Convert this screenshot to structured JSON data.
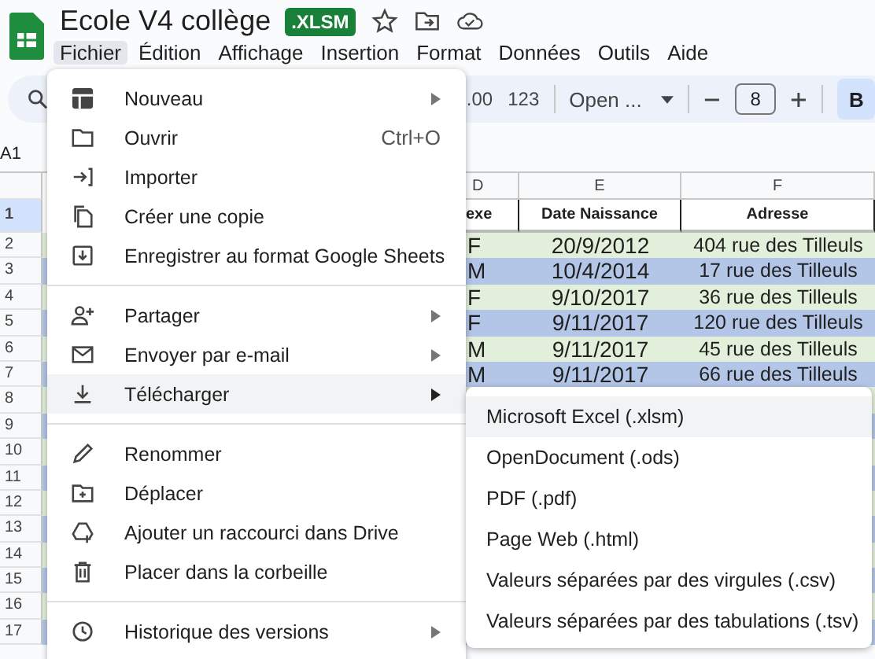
{
  "document": {
    "title": "Ecole V4 collège",
    "badge": ".XLSM"
  },
  "menu_bar": [
    {
      "label": "Fichier",
      "selected": true
    },
    {
      "label": "Édition",
      "selected": false
    },
    {
      "label": "Affichage",
      "selected": false
    },
    {
      "label": "Insertion",
      "selected": false
    },
    {
      "label": "Format",
      "selected": false
    },
    {
      "label": "Données",
      "selected": false
    },
    {
      "label": "Outils",
      "selected": false
    },
    {
      "label": "Aide",
      "selected": false
    }
  ],
  "toolbar": {
    "decimal_button": ".00",
    "number_format_button": "123",
    "font_dropdown": "Open ...",
    "font_size": "8",
    "bold_button": {
      "label": "B",
      "on": true
    }
  },
  "name_box": "A1",
  "sheet": {
    "columns": [
      "D",
      "E",
      "F"
    ],
    "header_row": {
      "number": "1",
      "selected": true,
      "cells": [
        "exe",
        "Date Naissance",
        "Adresse"
      ]
    },
    "rows": [
      {
        "number": "2",
        "cells": [
          "F",
          "20/9/2012",
          "404 rue des Tilleuls"
        ]
      },
      {
        "number": "3",
        "cells": [
          "M",
          "10/4/2014",
          "17 rue des Tilleuls"
        ]
      },
      {
        "number": "4",
        "cells": [
          "F",
          "9/10/2017",
          "36 rue des Tilleuls"
        ]
      },
      {
        "number": "5",
        "cells": [
          "F",
          "9/11/2017",
          "120 rue des Tilleuls"
        ]
      },
      {
        "number": "6",
        "cells": [
          "M",
          "9/11/2017",
          "45 rue des Tilleuls"
        ]
      },
      {
        "number": "7",
        "cells": [
          "M",
          "9/11/2017",
          "66 rue des Tilleuls"
        ]
      },
      {
        "number": "8"
      },
      {
        "number": "9"
      },
      {
        "number": "10"
      },
      {
        "number": "11"
      },
      {
        "number": "12"
      },
      {
        "number": "13"
      },
      {
        "number": "14"
      },
      {
        "number": "15"
      },
      {
        "number": "16"
      },
      {
        "number": "17"
      }
    ]
  },
  "file_menu": {
    "sections": [
      [
        {
          "label": "Nouveau",
          "submenu": true,
          "selected": false
        },
        {
          "label": "Ouvrir",
          "shortcut": "Ctrl+O",
          "submenu": false,
          "selected": false
        },
        {
          "label": "Importer",
          "submenu": false,
          "selected": false
        },
        {
          "label": "Créer une copie",
          "submenu": false,
          "selected": false
        },
        {
          "label": "Enregistrer au format Google Sheets",
          "submenu": false,
          "selected": false
        }
      ],
      [
        {
          "label": "Partager",
          "submenu": true,
          "selected": false
        },
        {
          "label": "Envoyer par e-mail",
          "submenu": true,
          "selected": false
        },
        {
          "label": "Télécharger",
          "submenu": true,
          "selected": true
        }
      ],
      [
        {
          "label": "Renommer",
          "submenu": false,
          "selected": false
        },
        {
          "label": "Déplacer",
          "submenu": false,
          "selected": false
        },
        {
          "label": "Ajouter un raccourci dans Drive",
          "submenu": false,
          "selected": false
        },
        {
          "label": "Placer dans la corbeille",
          "submenu": false,
          "selected": false
        }
      ],
      [
        {
          "label": "Historique des versions",
          "submenu": true,
          "selected": false
        }
      ]
    ]
  },
  "download_submenu": {
    "items": [
      {
        "label": "Microsoft Excel (.xlsm)",
        "selected": true
      },
      {
        "label": "OpenDocument (.ods)",
        "selected": false
      },
      {
        "label": "PDF (.pdf)",
        "selected": false
      },
      {
        "label": "Page Web (.html)",
        "selected": false
      },
      {
        "label": "Valeurs séparées par des virgules (.csv)",
        "selected": false
      },
      {
        "label": "Valeurs séparées par des tabulations (.tsv)",
        "selected": false
      }
    ]
  }
}
